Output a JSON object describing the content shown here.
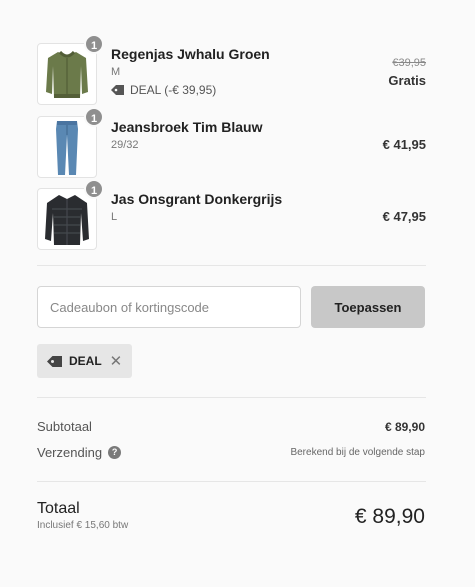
{
  "items": [
    {
      "name": "Regenjas Jwhalu Groen",
      "variant": "M",
      "qty": "1",
      "deal_label": "DEAL (-€ 39,95)",
      "old_price": "€39,95",
      "price": "Gratis",
      "image_icon": "green-jacket-icon"
    },
    {
      "name": "Jeansbroek Tim Blauw",
      "variant": "29/32",
      "qty": "1",
      "price": "€ 41,95",
      "image_icon": "blue-jeans-icon"
    },
    {
      "name": "Jas Onsgrant Donkergrijs",
      "variant": "L",
      "qty": "1",
      "price": "€ 47,95",
      "image_icon": "dark-puffer-jacket-icon"
    }
  ],
  "coupon": {
    "placeholder": "Cadeaubon of kortingscode",
    "apply_label": "Toepassen",
    "applied_code": "DEAL",
    "tag_icon": "tag-icon",
    "remove_icon": "close-icon"
  },
  "summary": {
    "subtotal_label": "Subtotaal",
    "subtotal_value": "€ 89,90",
    "shipping_label": "Verzending",
    "shipping_help": "?",
    "shipping_value": "Berekend bij de volgende stap",
    "total_label": "Totaal",
    "tax_note": "Inclusief € 15,60 btw",
    "total_value": "€ 89,90"
  },
  "colors": {
    "badge": "#8f8f8f",
    "button": "#c8c8c8",
    "chip": "#e6e6e6",
    "jacket_green": "#6b7a4a",
    "jeans_blue": "#5a88b3",
    "puffer_dark": "#2a2c30"
  }
}
